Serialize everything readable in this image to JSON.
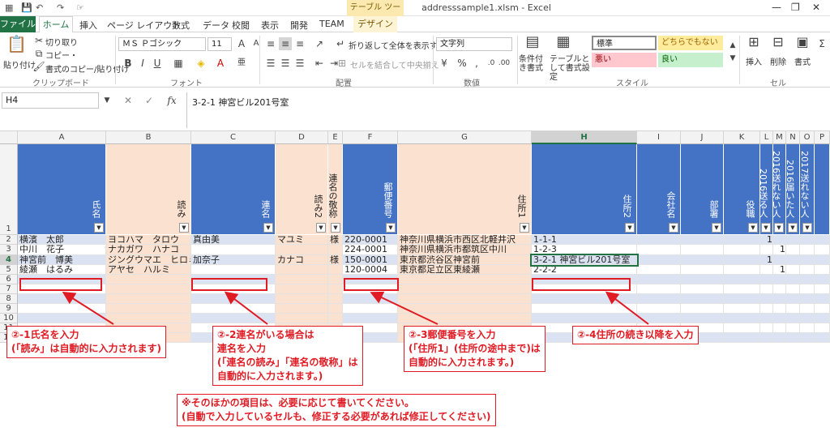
{
  "titlebar": {
    "contextual_group": "テーブル ツール",
    "window_title": "addresssample1.xlsm - Excel",
    "qa_save_icon": "save-icon",
    "qa_undo_icon": "undo-icon",
    "qa_redo_icon": "redo-icon"
  },
  "tabs": {
    "file": "ファイル",
    "home": "ホーム",
    "insert": "挿入",
    "page_layout": "ページ レイアウト",
    "formulas": "数式",
    "data": "データ",
    "review": "校閲",
    "view": "表示",
    "developer": "開発",
    "team": "TEAM",
    "design": "デザイン"
  },
  "ribbon": {
    "clipboard": {
      "paste": "貼り付け",
      "cut": "切り取り",
      "copy": "コピー・",
      "format_painter": "書式のコピー/貼り付け",
      "label": "クリップボード"
    },
    "font": {
      "name": "ＭＳ Ｐゴシック",
      "size": "11",
      "label": "フォント"
    },
    "alignment": {
      "wrap": "折り返して全体を表示する",
      "merge": "セルを結合して中央揃え",
      "label": "配置"
    },
    "number": {
      "format": "文字列",
      "label": "数値"
    },
    "styles": {
      "conditional": "条件付き書式",
      "as_table": "テーブルとして書式設定",
      "standard": "標準",
      "neutral": "どちらでもない",
      "bad": "悪い",
      "good": "良い",
      "label": "スタイル"
    },
    "cells": {
      "insert": "挿入",
      "delete": "削除",
      "format": "書式",
      "label": "セル"
    }
  },
  "formula_bar": {
    "name_box": "H4",
    "content": "3-2-1 神宮ビル201号室"
  },
  "columns": [
    "A",
    "B",
    "C",
    "D",
    "E",
    "F",
    "G",
    "H",
    "I",
    "J",
    "K",
    "L",
    "M",
    "N",
    "O",
    "P"
  ],
  "rows": [
    "1",
    "2",
    "3",
    "4",
    "5",
    "6",
    "7",
    "8",
    "9",
    "10",
    "11",
    "12"
  ],
  "headers": {
    "A": "氏名",
    "B": "読み",
    "C": "連名",
    "D": "読み2",
    "E": "連名の敬称",
    "F": "郵便番号",
    "G": "住所1",
    "H": "住所2",
    "I": "会社名",
    "J": "部署",
    "K": "役職",
    "L": "2016送る人",
    "M": "2016送れない人",
    "N": "2016届いた人",
    "O": "2017送れない人"
  },
  "data_rows": [
    {
      "A": "横濱　太郎",
      "B": "ヨコハマ　タロウ",
      "C": "真由美",
      "D": "マユミ",
      "E": "様",
      "F": "220-0001",
      "G": "神奈川県横浜市西区北軽井沢",
      "H": "1-1-1",
      "L": "1",
      "M": ""
    },
    {
      "A": "中川　花子",
      "B": "ナカガワ　ハナコ",
      "C": "",
      "D": "",
      "E": "",
      "F": "224-0001",
      "G": "神奈川県横浜市都筑区中川",
      "H": "1-2-3",
      "L": "",
      "M": "1"
    },
    {
      "A": "神宮前　博美",
      "B": "ジングウマエ　ヒロミ",
      "C": "加奈子",
      "D": "カナコ",
      "E": "様",
      "F": "150-0001",
      "G": "東京都渋谷区神宮前",
      "H": "3-2-1 神宮ビル201号室",
      "L": "1",
      "M": ""
    },
    {
      "A": "綾瀬　はるみ",
      "B": "アヤセ　ハルミ",
      "C": "",
      "D": "",
      "E": "",
      "F": "120-0004",
      "G": "東京都足立区東綾瀬",
      "H": "2-2-2",
      "L": "",
      "M": "1"
    }
  ],
  "callouts": {
    "name": [
      "②-1氏名を入力",
      "(「読み」は自動的に入力されます)"
    ],
    "joint": [
      "②-2連名がいる場合は",
      "連名を入力",
      "(「連名の読み」「連名の敬称」は",
      "自動的に入力されます。)"
    ],
    "postal": [
      "②-3郵便番号を入力",
      "(「住所1」(住所の途中まで)は",
      "自動的に入力されます。)"
    ],
    "address": [
      "②-4住所の続き以降を入力"
    ],
    "note": [
      "※そのほかの項目は、必要に応じて書いてください。",
      "(自動で入力しているセルも、修正する必要があれば修正してください)"
    ]
  },
  "colors": {
    "excel_green": "#217346",
    "header_blue": "#4472c4",
    "header_peach": "#fbe1cf",
    "callout_red": "#e01b24"
  }
}
